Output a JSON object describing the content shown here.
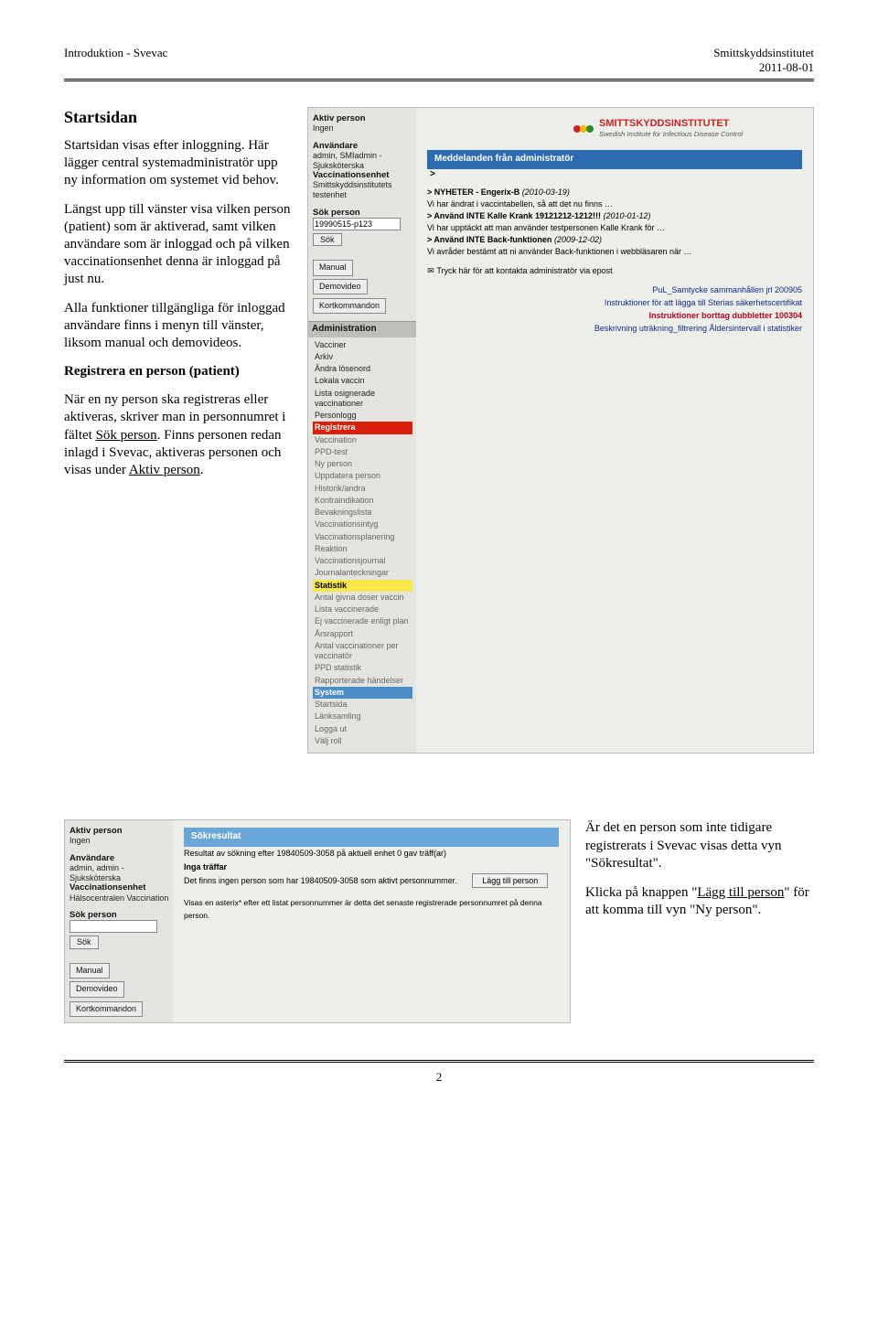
{
  "header": {
    "left": "Introduktion - Svevac",
    "right1": "Smittskyddsinstitutet",
    "right2": "2011-08-01"
  },
  "section1": {
    "title": "Startsidan",
    "p1": "Startsidan visas efter inloggning. Här lägger central systemadministratör upp ny information om systemet vid behov.",
    "p2": "Längst upp till vänster visa vilken person (patient) som är aktiverad, samt vilken användare som är inloggad och på vilken vaccinationsenhet denna är inloggad på just nu.",
    "p3": "Alla funktioner tillgängliga för inloggad användare finns i menyn till vänster, liksom manual och demovideos.",
    "sub": "Registrera en person (patient)",
    "p4a": "När en ny person ska registreras eller aktiveras, skriver man in personnumret i fältet ",
    "p4b": "Sök person",
    "p4c": ". Finns personen redan inlagd i Svevac, aktiveras personen och visas under ",
    "p4d": "Aktiv person",
    "p4e": "."
  },
  "app": {
    "aktiv": "Aktiv person",
    "ingen": "Ingen",
    "anv": "Användare",
    "anv_val": "admin, SMIadmin - Sjuksköterska",
    "venhet": "Vaccinationsenhet",
    "venhet_val": "Smittskyddsinstitutets testenhet",
    "sok": "Sök person",
    "sok_val": "19990515-p123",
    "sok_btn": "Sök",
    "manual": "Manual",
    "demo": "Demovideo",
    "kort": "Kortkommandon",
    "adminhdr": "Administration",
    "nav": [
      "Vacciner",
      "Arkiv",
      "Ändra lösenord",
      "Lokala vaccin",
      "Lista osignerade vaccinationer",
      "Personlogg"
    ],
    "reg": "Registrera",
    "nav2": [
      "Vaccination",
      "PPD-test",
      "Ny person",
      "Uppdatera person",
      "Historik/andra",
      "Kontraindikation",
      "Bevakningslista",
      "Vaccinationsintyg",
      "Vaccinationsplanering",
      "Reaktion",
      "Vaccinationsjournal",
      "Journalanteckningar"
    ],
    "stat": "Statistik",
    "nav3": [
      "Antal givna doser vaccin",
      "Lista vaccinerade",
      "Ej vaccinerade enligt plan",
      "Årsrapport",
      "Antal vaccinationer per vaccinatör",
      "PPD statistik",
      "Rapporterade händelser"
    ],
    "sys": "System",
    "nav4": [
      "Startsida",
      "Länksamling",
      "Logga ut",
      "Välj roll"
    ],
    "brand1": "SMITTSKYDDSINSTITUTET",
    "brand2": "Swedish Institute for Infectious Disease Control",
    "bluebar": "Meddelanden från administratör",
    "angle": ">",
    "news": [
      {
        "b": "> NYHETER - Engerix-B ",
        "i": "(2010-03-19)",
        "t": "Vi har ändrat i vaccintabellen, så att det nu finns …"
      },
      {
        "b": "> Använd INTE Kalle Krank 19121212-1212!!! ",
        "i": "(2010-01-12)",
        "t": "Vi har upptäckt att man använder testpersonen Kalle Krank för …"
      },
      {
        "b": "> Använd INTE Back-funktionen ",
        "i": "(2009-12-02)",
        "t": "Vi avråder bestämt att ni använder Back-funktionen i webbläsaren när …"
      }
    ],
    "mail": "Tryck här för att kontakta administratör via epost",
    "rnotes": {
      "r1a": "PuL_Samtycke sammanhållen jrl 200905",
      "r1b": "Instruktioner för att lägga till Sterias säkerhetscertifikat",
      "r2": "Instruktioner borttag dubbletter 100304",
      "r1c": "Beskrivning uträkning_filtrering Åldersintervall i statistiker"
    }
  },
  "app2": {
    "aktiv": "Aktiv person",
    "ingen": "Ingen",
    "anv": "Användare",
    "anv_val": "admin, admin - Sjuksköterska",
    "venhet": "Vaccinationsenhet",
    "venhet_val": "Hälsocentralen Vaccination",
    "sok": "Sök person",
    "sok_val": "",
    "sok_btn": "Sök",
    "manual": "Manual",
    "demo": "Demovideo",
    "kort": "Kortkommandon",
    "bluebar": "Sökresultat",
    "l1": "Resultat av sökning efter 19840509-3058 på aktuell enhet 0 gav träff(ar)",
    "l2": "Inga träffar",
    "l3": "Det finns ingen person som har 19840509-3058 som aktivt personnummer.",
    "lagg": "Lägg till person",
    "l4": "Visas en asterix* efter ett listat personnummer är detta det senaste registrerade personnumret på denna person."
  },
  "right2": {
    "p1": "Är det en person som inte tidigare registrerats i Svevac visas detta vyn \"Sökresultat\".",
    "p2a": "Klicka på knappen \"",
    "p2b": "Lägg till person",
    "p2c": "\" för att komma till vyn \"Ny person\"."
  },
  "footer": "2"
}
